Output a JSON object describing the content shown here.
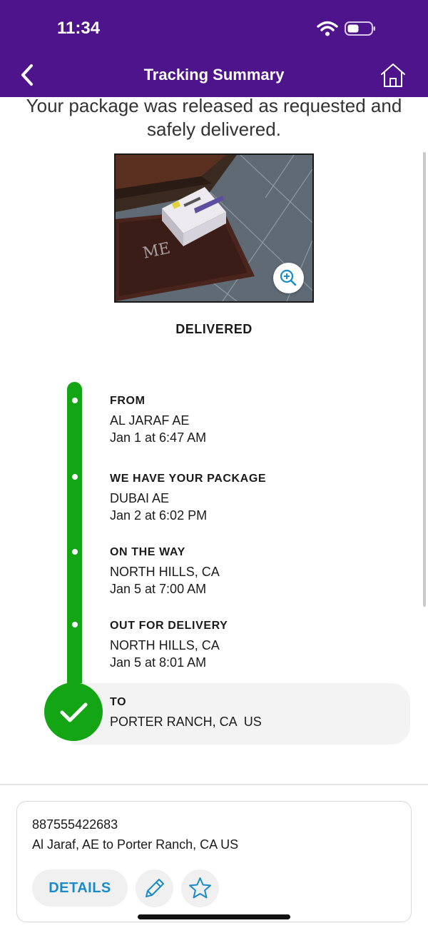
{
  "status_bar": {
    "time": "11:34",
    "icons": [
      "wifi-icon",
      "battery-icon"
    ]
  },
  "header": {
    "title": "Tracking Summary",
    "back_icon": "chevron-left-icon",
    "home_icon": "home-icon"
  },
  "message": "Your package was released as requested and safely delivered.",
  "photo": {
    "alt": "Photo of delivered package on doormat",
    "zoom_icon": "zoom-in-icon"
  },
  "status": "DELIVERED",
  "timeline": [
    {
      "label": "FROM",
      "lines": [
        "AL JARAF AE",
        "Jan 1 at 6:47 AM"
      ]
    },
    {
      "label": "WE HAVE YOUR PACKAGE",
      "lines": [
        "DUBAI AE",
        "Jan 2 at 6:02 PM"
      ]
    },
    {
      "label": "ON THE WAY",
      "lines": [
        "NORTH HILLS, CA",
        "Jan 5 at 7:00 AM"
      ]
    },
    {
      "label": "OUT FOR DELIVERY",
      "lines": [
        "NORTH HILLS, CA",
        "Jan 5 at 8:01 AM"
      ]
    },
    {
      "label": "TO",
      "lines": [
        "PORTER RANCH, CA  US"
      ]
    }
  ],
  "shipment_card": {
    "tracking_number": "887555422683",
    "route": "Al Jaraf, AE to Porter Ranch, CA US",
    "details_label": "DETAILS",
    "edit_icon": "pencil-icon",
    "watch_icon": "star-icon"
  },
  "colors": {
    "header": "#4d148c",
    "progress": "#14a514",
    "link": "#1b8acb"
  }
}
